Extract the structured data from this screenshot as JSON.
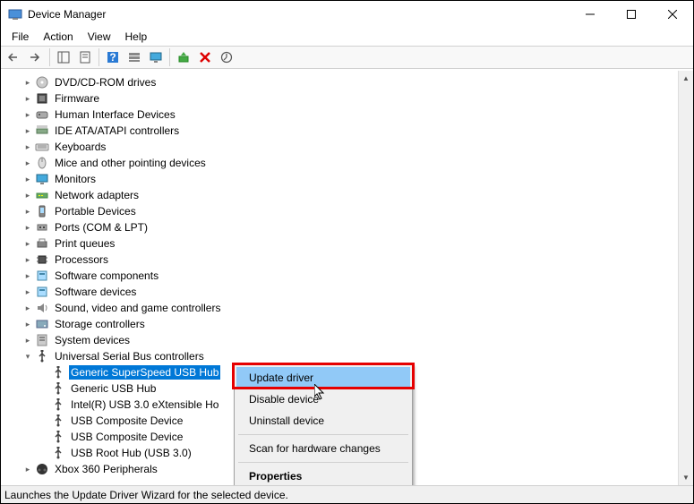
{
  "window": {
    "title": "Device Manager"
  },
  "menubar": [
    "File",
    "Action",
    "View",
    "Help"
  ],
  "tree": {
    "items": [
      {
        "label": "DVD/CD-ROM drives",
        "icon": "disc",
        "expander": ">"
      },
      {
        "label": "Firmware",
        "icon": "chip",
        "expander": ">"
      },
      {
        "label": "Human Interface Devices",
        "icon": "hid",
        "expander": ">"
      },
      {
        "label": "IDE ATA/ATAPI controllers",
        "icon": "ide",
        "expander": ">"
      },
      {
        "label": "Keyboards",
        "icon": "keyboard",
        "expander": ">"
      },
      {
        "label": "Mice and other pointing devices",
        "icon": "mouse",
        "expander": ">"
      },
      {
        "label": "Monitors",
        "icon": "monitor",
        "expander": ">"
      },
      {
        "label": "Network adapters",
        "icon": "network",
        "expander": ">"
      },
      {
        "label": "Portable Devices",
        "icon": "portable",
        "expander": ">"
      },
      {
        "label": "Ports (COM & LPT)",
        "icon": "port",
        "expander": ">"
      },
      {
        "label": "Print queues",
        "icon": "printer",
        "expander": ">"
      },
      {
        "label": "Processors",
        "icon": "cpu",
        "expander": ">"
      },
      {
        "label": "Software components",
        "icon": "software",
        "expander": ">"
      },
      {
        "label": "Software devices",
        "icon": "software",
        "expander": ">"
      },
      {
        "label": "Sound, video and game controllers",
        "icon": "sound",
        "expander": ">"
      },
      {
        "label": "Storage controllers",
        "icon": "storage",
        "expander": ">"
      },
      {
        "label": "System devices",
        "icon": "system",
        "expander": ">"
      },
      {
        "label": "Universal Serial Bus controllers",
        "icon": "usb",
        "expander": "v",
        "expanded": true,
        "children": [
          {
            "label": "Generic SuperSpeed USB Hub",
            "icon": "usb",
            "selected": true
          },
          {
            "label": "Generic USB Hub",
            "icon": "usb"
          },
          {
            "label": "Intel(R) USB 3.0 eXtensible Ho",
            "icon": "usb"
          },
          {
            "label": "USB Composite Device",
            "icon": "usb"
          },
          {
            "label": "USB Composite Device",
            "icon": "usb"
          },
          {
            "label": "USB Root Hub (USB 3.0)",
            "icon": "usb"
          }
        ]
      },
      {
        "label": "Xbox 360 Peripherals",
        "icon": "xbox",
        "expander": ">"
      }
    ]
  },
  "context_menu": {
    "items": [
      {
        "label": "Update driver",
        "highlight": true
      },
      {
        "label": "Disable device"
      },
      {
        "label": "Uninstall device"
      },
      {
        "sep": true
      },
      {
        "label": "Scan for hardware changes"
      },
      {
        "sep": true
      },
      {
        "label": "Properties",
        "bold": true
      }
    ]
  },
  "statusbar": "Launches the Update Driver Wizard for the selected device."
}
